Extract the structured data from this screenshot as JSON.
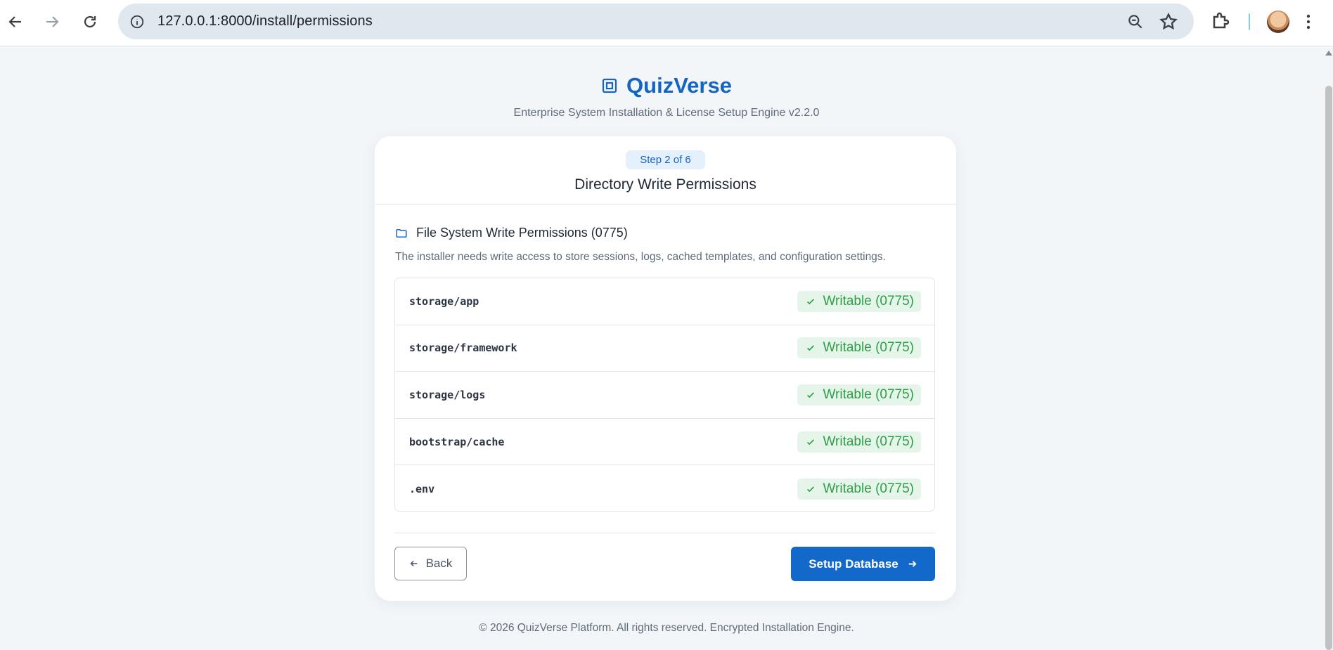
{
  "browser": {
    "url": "127.0.0.1:8000/install/permissions"
  },
  "header": {
    "title": "QuizVerse",
    "subtitle": "Enterprise System Installation & License Setup Engine v2.2.0"
  },
  "card": {
    "step_label": "Step 2 of 6",
    "title": "Directory Write Permissions",
    "section_title": "File System Write Permissions (0775)",
    "section_desc": "The installer needs write access to store sessions, logs, cached templates, and configuration settings.",
    "permissions": [
      {
        "path": "storage/app",
        "status": "Writable (0775)"
      },
      {
        "path": "storage/framework",
        "status": "Writable (0775)"
      },
      {
        "path": "storage/logs",
        "status": "Writable (0775)"
      },
      {
        "path": "bootstrap/cache",
        "status": "Writable (0775)"
      },
      {
        "path": ".env",
        "status": "Writable (0775)"
      }
    ],
    "back_label": "Back",
    "next_label": "Setup Database"
  },
  "footer": {
    "text": "© 2026 QuizVerse Platform. All rights reserved. Encrypted Installation Engine."
  },
  "colors": {
    "brand": "#1565c0",
    "primary_button": "#1369c9",
    "success_text": "#2e9e48",
    "success_bg": "#e6f5ea",
    "page_bg": "#f3f6f9"
  }
}
